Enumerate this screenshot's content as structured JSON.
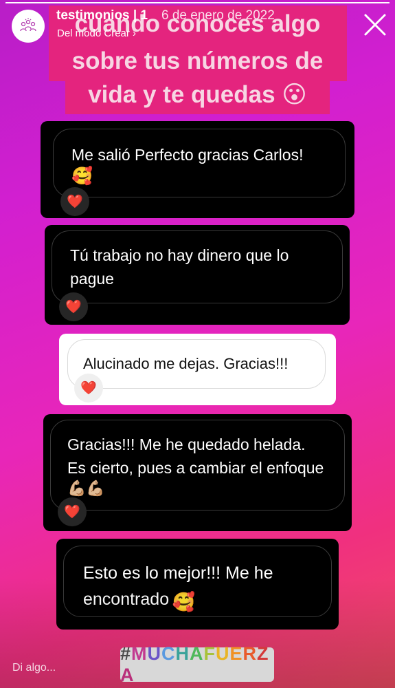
{
  "story": {
    "progress_fraction": 1.0,
    "account_name": "testimonios | 1",
    "date": "6 de enero de 2022",
    "subtitle": "Del modo Crear",
    "subtitle_chevron": "›",
    "avatar_icon": "people-line-art-icon",
    "close_icon": "close-icon",
    "title_lines": [
      "cuando conoces algo",
      "sobre tus números de",
      "vida y te quedas 😮"
    ],
    "title_band_color": "#e4247e"
  },
  "messages": [
    {
      "text": "Me salió Perfecto gracias Carlos!",
      "emoji": "🥰",
      "reaction": "❤️",
      "card_style": "dark"
    },
    {
      "text": "Tú trabajo no hay dinero que lo pague",
      "reaction": "❤️",
      "card_style": "dark"
    },
    {
      "text": "Alucinado me dejas. Gracias!!!",
      "reaction": "❤️",
      "card_style": "light"
    },
    {
      "text": "Gracias!!! Me he quedado helada. Es cierto, pues a cambiar el enfoque",
      "emoji": "💪🏼💪🏼",
      "reaction": "❤️",
      "card_style": "dark"
    },
    {
      "text": "Esto es lo mejor!!! Me he encontrado",
      "emoji": "🥰",
      "card_style": "dark"
    }
  ],
  "footer": {
    "reply_placeholder": "Di algo...",
    "hashtag": "#MUCHAFUERZA",
    "hashtag_letter_colors": [
      "#4a4a4a",
      "#c23a90",
      "#6a55c7",
      "#5a9ae0",
      "#3aa39a",
      "#4eb85a",
      "#a8c23a",
      "#e8b526",
      "#f09224",
      "#e85b2c",
      "#d43a3a",
      "#b92f7a"
    ]
  }
}
